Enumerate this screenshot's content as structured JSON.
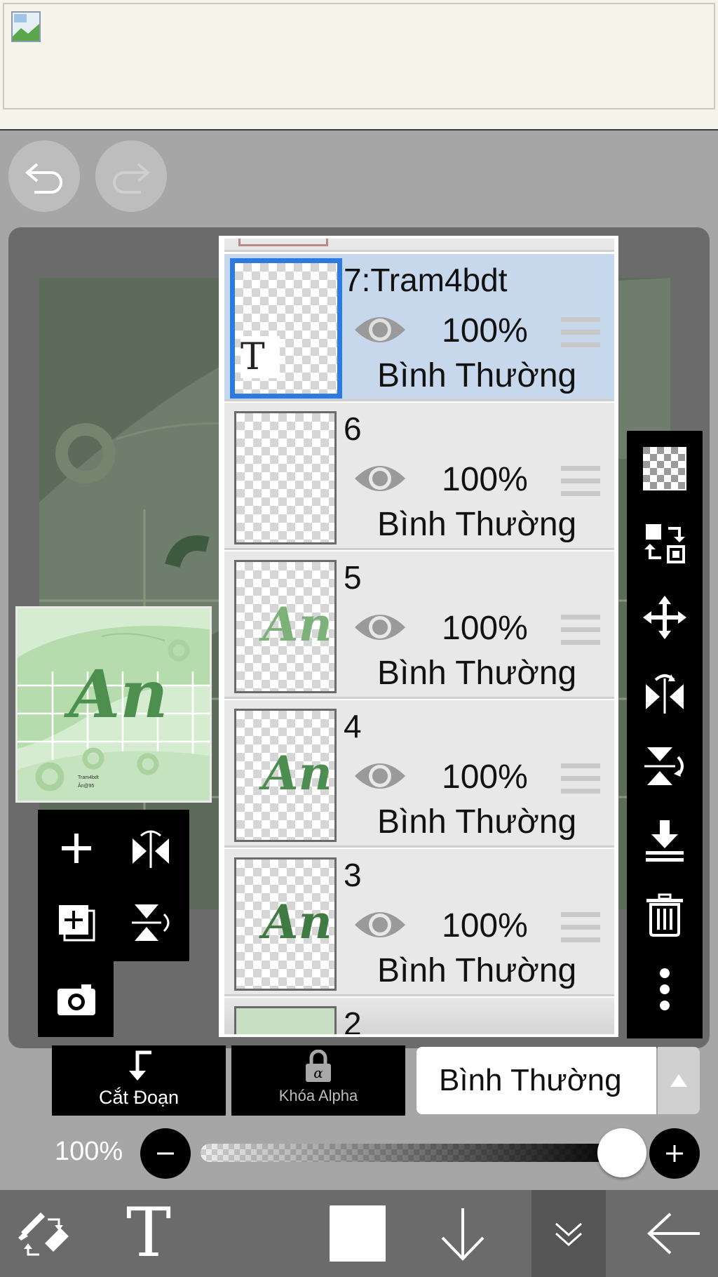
{
  "ad_banner": {
    "image_alt": "broken-image-icon"
  },
  "history": {
    "undo_icon": "undo-icon",
    "redo_icon": "redo-icon"
  },
  "layers": [
    {
      "name": "7:Tram4bdt",
      "opacity": "100%",
      "blend": "Bình Thường",
      "selected": true,
      "thumb_text": "T"
    },
    {
      "name": "6",
      "opacity": "100%",
      "blend": "Bình Thường",
      "selected": false,
      "thumb_text": ""
    },
    {
      "name": "5",
      "opacity": "100%",
      "blend": "Bình Thường",
      "selected": false,
      "thumb_text": "An"
    },
    {
      "name": "4",
      "opacity": "100%",
      "blend": "Bình Thường",
      "selected": false,
      "thumb_text": "An"
    },
    {
      "name": "3",
      "opacity": "100%",
      "blend": "Bình Thường",
      "selected": false,
      "thumb_text": "An"
    },
    {
      "name": "2",
      "opacity": "",
      "blend": "",
      "selected": false,
      "thumb_text": ""
    }
  ],
  "preview": {
    "art_text": "An",
    "caption_line1": "Tram4bdt",
    "caption_line2": "Ân@95"
  },
  "controls": {
    "clipping_label": "Cắt Đoạn",
    "alpha_lock_label": "Khóa Alpha",
    "blend_mode": "Bình Thường",
    "opacity_label": "100%",
    "opacity_value": 1.0
  },
  "right_toolbar": [
    "checker-icon",
    "transfer-icon",
    "move-icon",
    "flip-horizontal-icon",
    "flip-vertical-icon",
    "merge-down-icon",
    "trash-icon",
    "more-icon"
  ],
  "bottom_toolbar": [
    "brush-eraser-swap-icon",
    "text-tool-icon",
    "color-swatch",
    "down-arrow-icon",
    "collapse-icon",
    "back-arrow-icon"
  ],
  "colors": {
    "accent": "#2e7be0",
    "selected_layer_bg": "#c7d7ec",
    "art_green": "#5e9e60"
  }
}
